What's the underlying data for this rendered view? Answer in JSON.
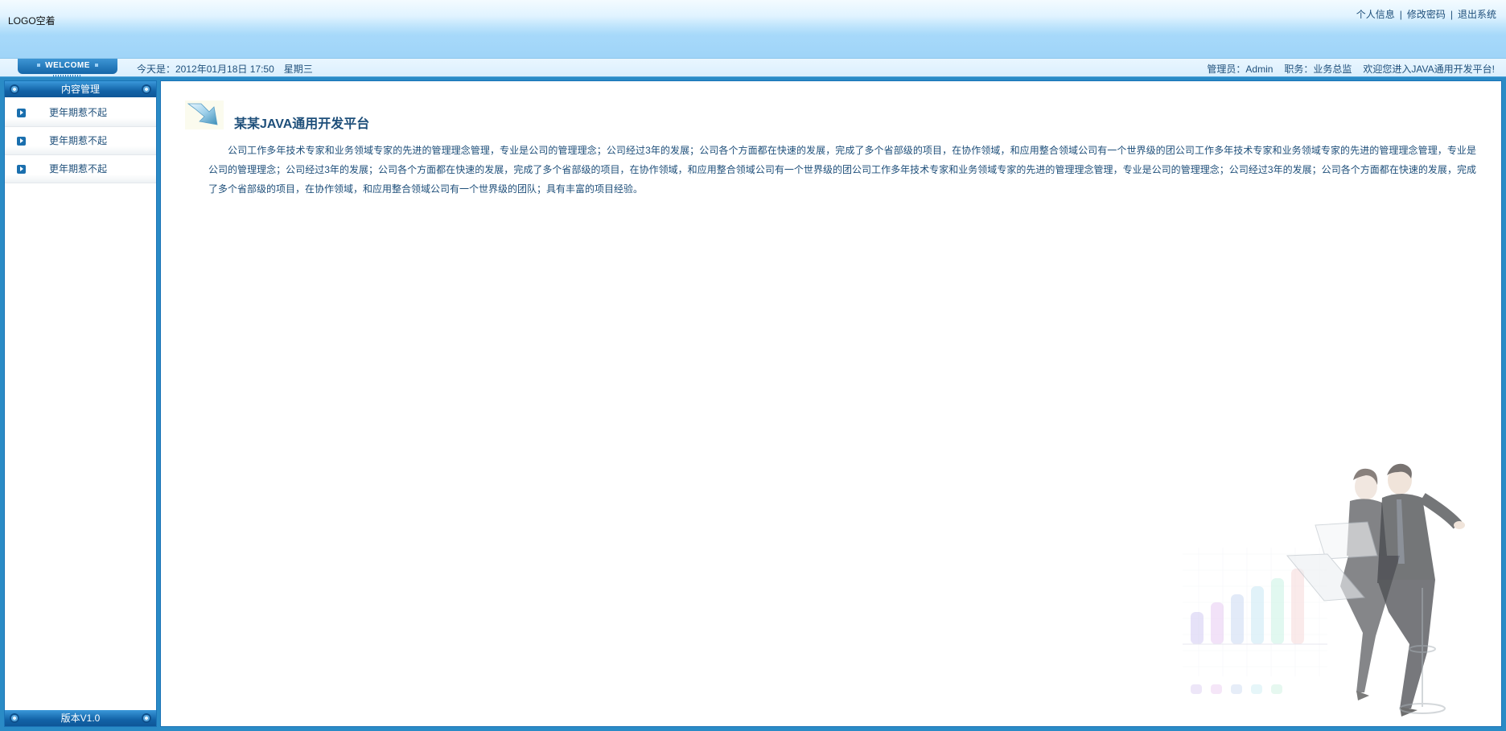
{
  "header": {
    "logo": "LOGO空着",
    "links": {
      "profile": "个人信息",
      "change_password": "修改密码",
      "logout": "退出系统"
    },
    "separator": "|"
  },
  "infobar": {
    "welcome": "WELCOME",
    "date": "今天是：2012年01月18日 17:50",
    "weekday": "星期三",
    "user": "管理员：Admin",
    "role": "职务：业务总监",
    "greeting": "欢迎您进入JAVA通用开发平台!"
  },
  "sidebar": {
    "header": "内容管理",
    "items": [
      {
        "label": "更年期惹不起",
        "icon": "arrow-right-icon"
      },
      {
        "label": "更年期惹不起",
        "icon": "arrow-right-icon"
      },
      {
        "label": "更年期惹不起",
        "icon": "arrow-right-icon"
      }
    ],
    "footer": "版本V1.0"
  },
  "content": {
    "title": "某某JAVA通用开发平台",
    "intro": "公司工作多年技术专家和业务领域专家的先进的管理理念管理，专业是公司的管理理念；公司经过3年的发展；公司各个方面都在快速的发展，完成了多个省部级的项目，在协作领域，和应用整合领域公司有一个世界级的团公司工作多年技术专家和业务领域专家的先进的管理理念管理，专业是公司的管理理念；公司经过3年的发展；公司各个方面都在快速的发展，完成了多个省部级的项目，在协作领域，和应用整合领域公司有一个世界级的团公司工作多年技术专家和业务领域专家的先进的管理理念管理，专业是公司的管理理念；公司经过3年的发展；公司各个方面都在快速的发展，完成了多个省部级的项目，在协作领域，和应用整合领域公司有一个世界级的团队；具有丰富的项目经验。"
  },
  "colors": {
    "frame_blue": "#2a8bc6",
    "header_sky": "#9fd4f8",
    "text_blue": "#1e4f7a",
    "panel_dark": "#1263a7"
  }
}
